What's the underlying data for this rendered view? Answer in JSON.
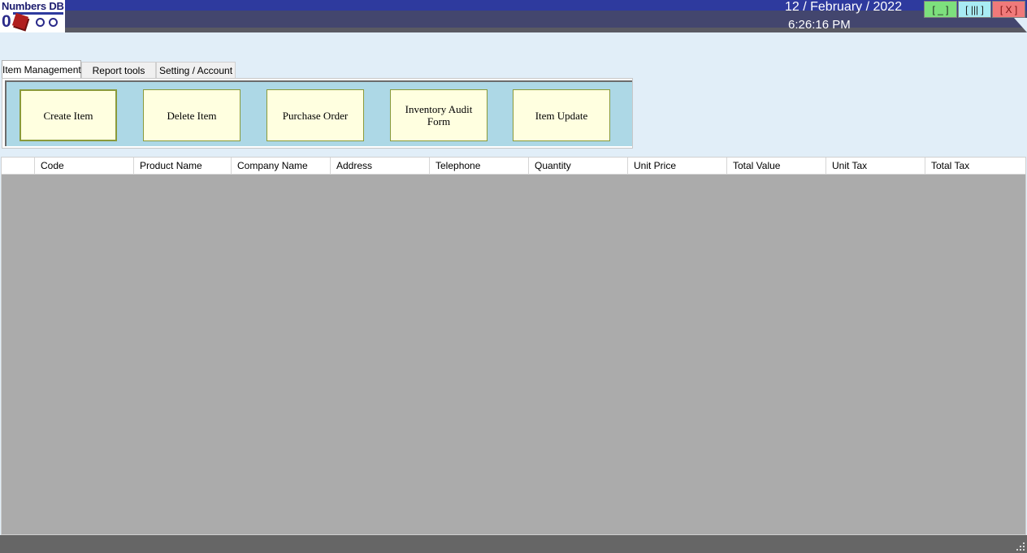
{
  "app": {
    "logo_text": "Numbers DB",
    "logo_digit": "0"
  },
  "header": {
    "date": "12 / February / 2022",
    "time": "6:26:16 PM"
  },
  "window_controls": {
    "minimize": "[ _ ]",
    "maximize": "[ ||| ]",
    "close": "[ X ]"
  },
  "tabs": [
    {
      "label": "Item Management",
      "active": true
    },
    {
      "label": "Report tools",
      "active": false
    },
    {
      "label": "Setting / Account",
      "active": false
    }
  ],
  "actions": [
    {
      "label": "Create Item"
    },
    {
      "label": "Delete Item"
    },
    {
      "label": "Purchase Order"
    },
    {
      "label": "Inventory Audit Form"
    },
    {
      "label": "Item Update"
    }
  ],
  "grid": {
    "columns": [
      "",
      "Code",
      "Product Name",
      "Company Name",
      "Address",
      "Telephone",
      "Quantity",
      "Unit Price",
      "Total Value",
      "Unit Tax",
      "Total Tax"
    ],
    "rows": []
  },
  "colors": {
    "title_bar": "#2e3a9e",
    "panel": "#add8e6",
    "action_button": "#ffffe0",
    "grid_background": "#ababab"
  }
}
